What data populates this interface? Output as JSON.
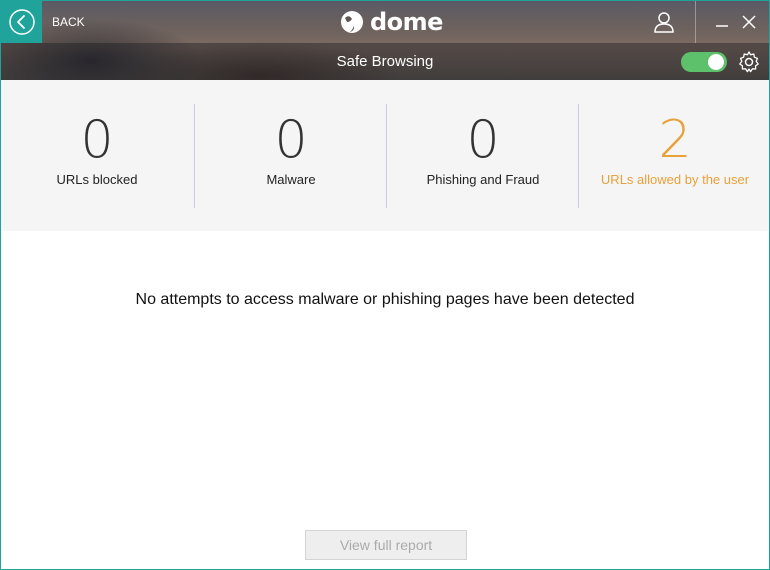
{
  "header": {
    "back_label": "BACK",
    "logo_text": "dome",
    "page_title": "Safe Browsing",
    "toggle_on": true
  },
  "stats": [
    {
      "value": "0",
      "label": "URLs blocked"
    },
    {
      "value": "0",
      "label": "Malware"
    },
    {
      "value": "0",
      "label": "Phishing and Fraud"
    },
    {
      "value": "2",
      "label": "URLs allowed by the user"
    }
  ],
  "main": {
    "message": "No attempts to access malware or phishing pages have been detected",
    "report_button": "View full report"
  },
  "colors": {
    "accent": "#1fa39a",
    "toggle": "#5cc16a",
    "highlight": "#e8a13a"
  }
}
